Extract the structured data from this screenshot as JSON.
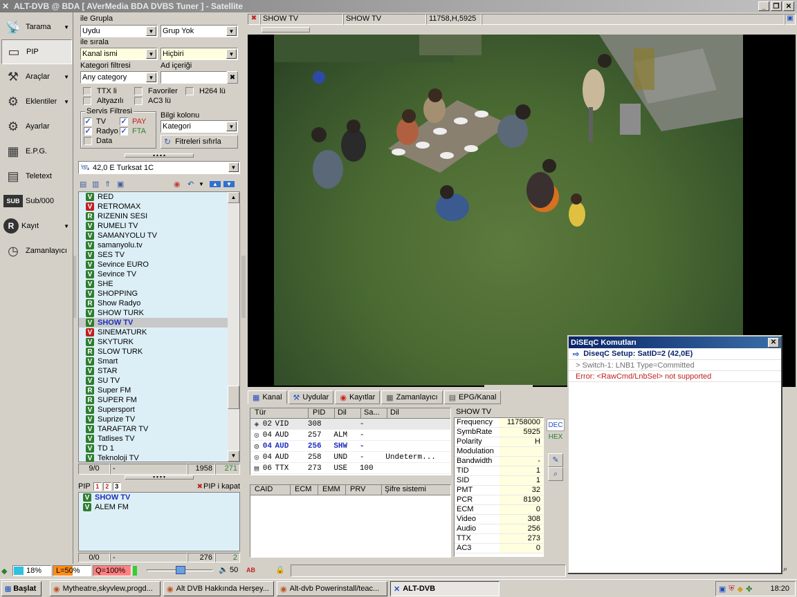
{
  "window": {
    "title": "ALT-DVB @ BDA [ AVerMedia BDA DVBS Tuner ] - Satellite"
  },
  "nav": [
    {
      "label": "Tarama",
      "icon": "satellite-dish-icon",
      "arrow": true
    },
    {
      "label": "PIP",
      "icon": "pip-icon",
      "arrow": false
    },
    {
      "label": "Araçlar",
      "icon": "tools-icon",
      "arrow": true
    },
    {
      "label": "Eklentiler",
      "icon": "plugins-icon",
      "arrow": true
    },
    {
      "label": "Ayarlar",
      "icon": "gear-icon",
      "arrow": false
    },
    {
      "label": "E.P.G.",
      "icon": "epg-icon",
      "arrow": false
    },
    {
      "label": "Teletext",
      "icon": "teletext-icon",
      "arrow": false
    },
    {
      "label": "Sub/000",
      "icon": "sub-icon",
      "arrow": false
    },
    {
      "label": "Kayıt",
      "icon": "record-icon",
      "arrow": true
    },
    {
      "label": "Zamanlayıcı",
      "icon": "clock-icon",
      "arrow": false
    }
  ],
  "filters": {
    "group_label": "ile Grupla",
    "group_value": "Uydu",
    "group2_value": "Grup Yok",
    "sort_label": "ile sırala",
    "sort_value": "Kanal ismi",
    "sort2_value": "Hiçbiri",
    "category_label": "Kategori filtresi",
    "category_value": "Any category",
    "name_label": "Ad içeriği",
    "name_value": "",
    "ttx": "TTX li",
    "favorites": "Favoriler",
    "h264": "H264 lü",
    "subtitled": "Altyazılı",
    "ac3": "AC3 lü",
    "service_title": "Servis Filtresi",
    "tv": "TV",
    "pay": "PAY",
    "radio": "Radyo",
    "fta": "FTA",
    "data": "Data",
    "info_col_label": "Bilgi kolonu",
    "info_col_value": "Kategori",
    "reset": "Fitreleri sıfırla"
  },
  "satellite": "42,0 E Turksat 1C",
  "channels": [
    {
      "type": "V",
      "name": "RED"
    },
    {
      "type": "Vr",
      "name": "RETROMAX"
    },
    {
      "type": "R",
      "name": "RIZENIN SESI"
    },
    {
      "type": "V",
      "name": "RUMELI TV"
    },
    {
      "type": "V",
      "name": "SAMANYOLU TV"
    },
    {
      "type": "V",
      "name": "samanyolu.tv"
    },
    {
      "type": "V",
      "name": "SES TV"
    },
    {
      "type": "V",
      "name": "Sevince EURO"
    },
    {
      "type": "V",
      "name": "Sevince TV"
    },
    {
      "type": "V",
      "name": "SHE"
    },
    {
      "type": "V",
      "name": "SHOPPING"
    },
    {
      "type": "R",
      "name": "Show Radyo"
    },
    {
      "type": "V",
      "name": "SHOW TURK"
    },
    {
      "type": "V",
      "name": "SHOW TV",
      "selected": true
    },
    {
      "type": "Vr",
      "name": "SINEMATURK"
    },
    {
      "type": "V",
      "name": "SKYTURK"
    },
    {
      "type": "R",
      "name": "SLOW TURK"
    },
    {
      "type": "V",
      "name": "Smart"
    },
    {
      "type": "V",
      "name": "STAR"
    },
    {
      "type": "V",
      "name": "SU TV"
    },
    {
      "type": "R",
      "name": "Super FM"
    },
    {
      "type": "R",
      "name": "SUPER FM"
    },
    {
      "type": "V",
      "name": "Supersport"
    },
    {
      "type": "V",
      "name": "Suprize TV"
    },
    {
      "type": "V",
      "name": "TARAFTAR TV"
    },
    {
      "type": "V",
      "name": "Tatlises TV"
    },
    {
      "type": "V",
      "name": "TD 1"
    },
    {
      "type": "V",
      "name": "Teknoloji TV"
    }
  ],
  "channel_status": {
    "pos": "9/0",
    "dash": "-",
    "count": "1958",
    "green": "271"
  },
  "pip": {
    "label": "PIP",
    "nums": [
      "1",
      "2",
      "3"
    ],
    "close": "PIP i kapat",
    "items": [
      {
        "name": "SHOW TV",
        "selected": true
      },
      {
        "name": "ALEM FM"
      }
    ],
    "status": {
      "pos": "0/0",
      "dash": "-",
      "count": "276",
      "green": "2"
    }
  },
  "topbar": {
    "channel": "SHOW TV",
    "channel2": "SHOW TV",
    "freq": "11758,H,5925"
  },
  "tabs": [
    "Kanal",
    "Uydular",
    "Kayıtlar",
    "Zamanlayıcı",
    "EPG/Kanal"
  ],
  "pid_table": {
    "headers": [
      "Tür",
      "PID",
      "Dil",
      "Sa...",
      "Dil"
    ],
    "rows": [
      {
        "num": "02",
        "type": "VID",
        "pid": "308",
        "lang": "",
        "sa": "-",
        "dil": "",
        "hl": true
      },
      {
        "num": "04",
        "type": "AUD",
        "pid": "257",
        "lang": "ALM",
        "sa": "-",
        "dil": ""
      },
      {
        "num": "04",
        "type": "AUD",
        "pid": "256",
        "lang": "SHW",
        "sa": "-",
        "dil": "",
        "bold": true
      },
      {
        "num": "04",
        "type": "AUD",
        "pid": "258",
        "lang": "UND",
        "sa": "-",
        "dil": "Undeterm..."
      },
      {
        "num": "06",
        "type": "TTX",
        "pid": "273",
        "lang": "USE",
        "sa": "100",
        "dil": ""
      }
    ]
  },
  "ca_table": {
    "headers": [
      "CAID",
      "ECM",
      "EMM",
      "PRV",
      "Şifre sistemi"
    ]
  },
  "info": {
    "title": "SHOW TV",
    "rows": [
      {
        "k": "Frequency",
        "v": "11758000"
      },
      {
        "k": "SymbRate",
        "v": "5925"
      },
      {
        "k": "Polarity",
        "v": "H"
      },
      {
        "k": "Modulation",
        "v": ""
      },
      {
        "k": "Bandwidth",
        "v": "-"
      },
      {
        "k": "TID",
        "v": "1"
      },
      {
        "k": "SID",
        "v": "1"
      },
      {
        "k": "PMT",
        "v": "32"
      },
      {
        "k": "PCR",
        "v": "8190"
      },
      {
        "k": "ECM",
        "v": "0"
      },
      {
        "k": "Video",
        "v": "308"
      },
      {
        "k": "Audio",
        "v": "256"
      },
      {
        "k": "TTX",
        "v": "273"
      },
      {
        "k": "AC3",
        "v": "0"
      }
    ],
    "dec": "DEC",
    "hex": "HEX"
  },
  "diseqc": {
    "title": "DiSEqC Komutları",
    "line1": "DiseqC Setup: SatID=2 (42,0E)",
    "line2": "> Switch-1: LNB1 Type=Committed",
    "line3": "Error: <RawCmd/LnbSel> not supported"
  },
  "statusbar": {
    "signal": "18%",
    "level": "L=50%",
    "quality": "Q=100%",
    "volume_value": 50,
    "volume": "50",
    "ab": "AB"
  },
  "taskbar": {
    "start": "Başlat",
    "buttons": [
      "Mytheatre,skyvlew,progd...",
      "Alt DVB Hakkında Herşey...",
      "Alt-dvb Powerinstall/teac...",
      "ALT-DVB"
    ],
    "clock": "18:20"
  },
  "colors": {
    "accent_blue": "#0a246a",
    "selected_text": "#1e2fbf",
    "list_bg": "#ddeff6",
    "green": "#2e7d2e",
    "red": "#c02020"
  }
}
